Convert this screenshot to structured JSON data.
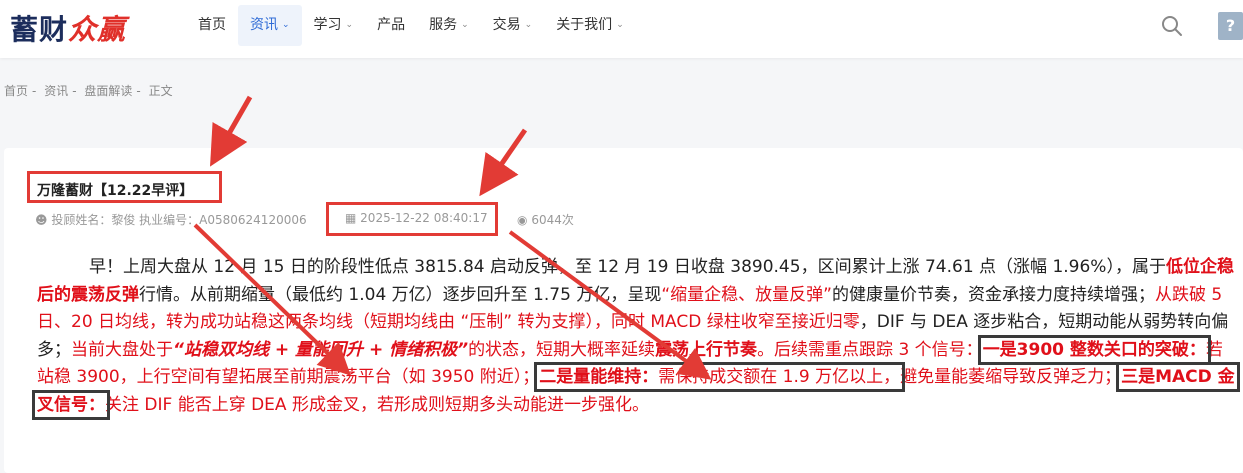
{
  "header": {
    "logo_main": "蓄财",
    "logo_accent": "众赢",
    "nav": [
      {
        "label": "首页",
        "has_menu": false,
        "active": false
      },
      {
        "label": "资讯",
        "has_menu": true,
        "active": true
      },
      {
        "label": "学习",
        "has_menu": true,
        "active": false
      },
      {
        "label": "产品",
        "has_menu": false,
        "active": false
      },
      {
        "label": "服务",
        "has_menu": true,
        "active": false
      },
      {
        "label": "交易",
        "has_menu": true,
        "active": false
      },
      {
        "label": "关于我们",
        "has_menu": true,
        "active": false
      }
    ]
  },
  "breadcrumb": {
    "items": [
      "首页",
      "资讯",
      "盘面解读",
      "正文"
    ],
    "sep": "-"
  },
  "article": {
    "title": "万隆蓄财【12.22早评】",
    "author": "投顾姓名：黎俊  执业编号：A0580624120006",
    "date": "2025-12-22 08:40:17",
    "views": "6044次",
    "p1": "早！上周大盘从 12 月 15 日的阶段性低点 3815.84 启动反弹，至 12 月 19 日收盘 3890.45，区间累计上涨 74.61 点（涨幅 1.96%），属于",
    "p2_red_bold": "低位企稳后的震荡反弹",
    "p3": "行情。从前期缩量（最低约 1.04 万亿）逐步回升至 1.75 万亿，呈现",
    "p4_red": "“缩量企稳、放量反弹”",
    "p5": "的健康量价节奏，资金承接力度持续增强；",
    "p6_red": "从跌破 5 日、20 日均线，转为成功站稳这两条均线（短期均线由 “压制” 转为支撑），同时 MACD 绿柱收窄至接近归零",
    "p7": "，DIF 与 DEA 逐步粘合，短期动能从弱势转向偏多；",
    "p8_red": "当前大盘处于",
    "p9_red_bi": "“站稳双均线 + 量能回升 + 情绪积极”",
    "p10_red": "的状态，短期大概率延续",
    "p11_red_bold": "震荡上行节奏",
    "p12_red": "。后续需重点跟踪 3 个信号：",
    "s1_title": "一是3900 整数关口的突破：",
    "s1_text": "若站稳 3900，上行空间有望拓展至前期震荡平台（如 3950 附近）；",
    "s2_title": "二是量能维持：",
    "s2_text": "需保持成交额在 1.9 万亿以上，",
    "s2_after": "避免量能萎缩导致反弹乏力；",
    "s3_title": "三是MACD 金叉信号：",
    "s3_text": "关注 DIF 能否上穿 DEA 形成金叉，若形成则短期多头动能进一步强化。"
  },
  "colors": {
    "accent_blue": "#2f6bd6",
    "highlight_red": "#e0101a",
    "annotation_red": "#e23b35",
    "logo_navy": "#1c2d5c"
  },
  "icons": {
    "search": "search-icon",
    "user": "user-icon",
    "calendar": "calendar-icon",
    "eye": "eye-icon"
  }
}
